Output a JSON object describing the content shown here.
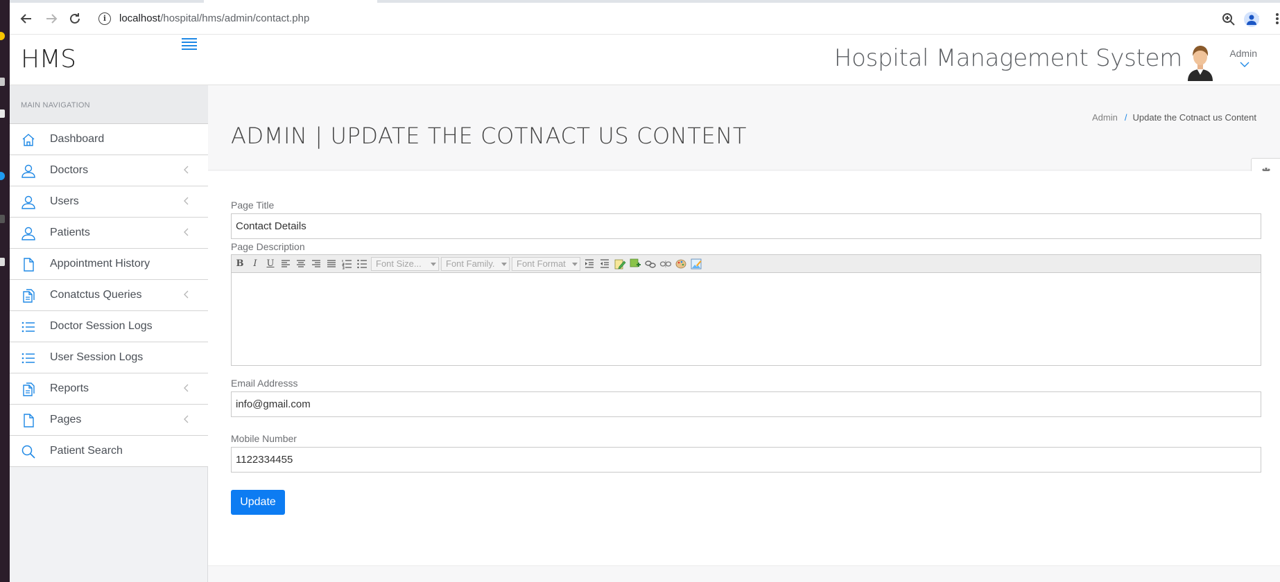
{
  "browser": {
    "url_host": "localhost",
    "url_path": "/hospital/hms/admin/contact.php"
  },
  "brand": {
    "name": "HMS"
  },
  "sidebar": {
    "header": "MAIN NAVIGATION",
    "items": [
      {
        "label": "Dashboard",
        "icon": "home-icon",
        "submenu": false
      },
      {
        "label": "Doctors",
        "icon": "user-icon",
        "submenu": true
      },
      {
        "label": "Users",
        "icon": "user-icon",
        "submenu": true
      },
      {
        "label": "Patients",
        "icon": "user-icon",
        "submenu": true
      },
      {
        "label": "Appointment History",
        "icon": "file-icon",
        "submenu": false
      },
      {
        "label": "Conatctus Queries",
        "icon": "files-icon",
        "submenu": true
      },
      {
        "label": "Doctor Session Logs",
        "icon": "list-icon",
        "submenu": false
      },
      {
        "label": "User Session Logs",
        "icon": "list-icon",
        "submenu": false
      },
      {
        "label": "Reports",
        "icon": "files-icon",
        "submenu": true
      },
      {
        "label": "Pages",
        "icon": "file-icon",
        "submenu": true
      },
      {
        "label": "Patient Search",
        "icon": "search-icon",
        "submenu": false
      }
    ]
  },
  "header": {
    "system_title": "Hospital Management System",
    "user_name": "Admin"
  },
  "page": {
    "title": "ADMIN | UPDATE THE COTNACT US CONTENT",
    "breadcrumb": [
      "Admin",
      "Update the Cotnact us Content"
    ]
  },
  "form": {
    "page_title_label": "Page Title",
    "page_title_value": "Contact Details",
    "page_description_label": "Page Description",
    "editor_selects": [
      "Font Size...",
      "Font Family.",
      "Font Format"
    ],
    "email_label": "Email Addresss",
    "email_value": "info@gmail.com",
    "mobile_label": "Mobile Number",
    "mobile_value": "1122334455",
    "submit_label": "Update"
  },
  "colors": {
    "accent": "#1e88e5",
    "button": "#0d7cf2"
  }
}
